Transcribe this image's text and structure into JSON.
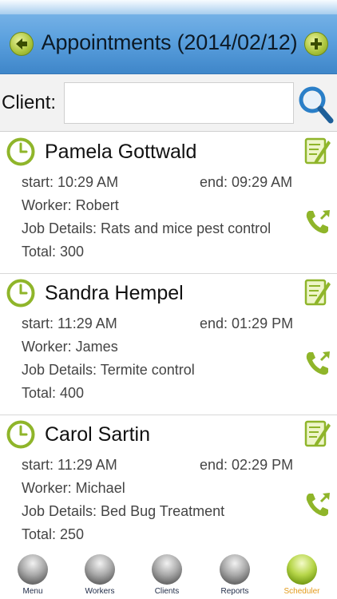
{
  "header": {
    "title": "Appointments (2014/02/12)",
    "back_icon": "arrow-left-icon",
    "add_icon": "plus-icon"
  },
  "search": {
    "label": "Client:",
    "value": "",
    "placeholder": "",
    "icon": "search-icon"
  },
  "appointments": [
    {
      "name": "Pamela Gottwald",
      "start": "start: 10:29 AM",
      "end": "end: 09:29 AM",
      "worker": "Worker: Robert",
      "details": "Job Details: Rats and mice pest control",
      "total": "Total: 300"
    },
    {
      "name": "Sandra Hempel",
      "start": "start: 11:29 AM",
      "end": "end: 01:29 PM",
      "worker": "Worker: James",
      "details": "Job Details: Termite control",
      "total": "Total: 400"
    },
    {
      "name": "Carol Sartin",
      "start": "start: 11:29 AM",
      "end": "end: 02:29 PM",
      "worker": "Worker: Michael",
      "details": "Job Details: Bed Bug Treatment",
      "total": "Total: 250"
    }
  ],
  "tabs": [
    {
      "label": "Menu",
      "active": false
    },
    {
      "label": "Workers",
      "active": false
    },
    {
      "label": "Clients",
      "active": false
    },
    {
      "label": "Reports",
      "active": false
    },
    {
      "label": "Scheduler",
      "active": true
    }
  ],
  "colors": {
    "header_blue": "#5aa0de",
    "accent_green": "#8fb52a",
    "active_tab": "#e39a1a"
  }
}
